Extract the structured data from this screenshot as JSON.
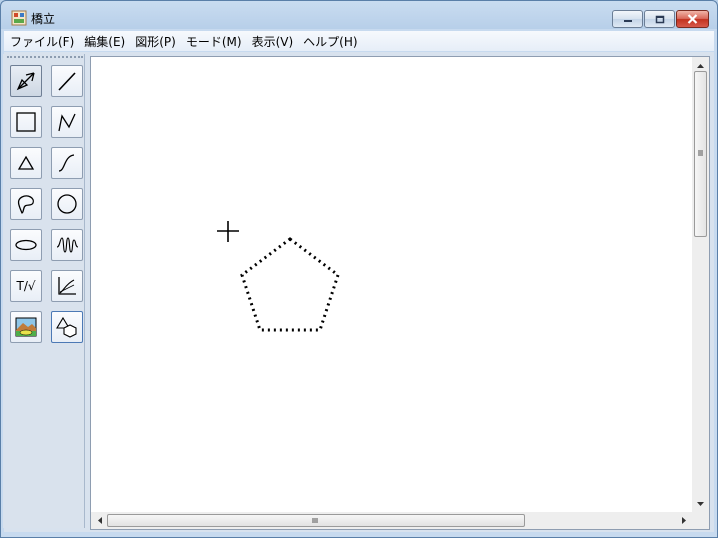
{
  "window": {
    "title": "橋立",
    "controls": {
      "minimize": "minimize-icon",
      "maximize": "maximize-icon",
      "close": "close-icon"
    }
  },
  "menubar": {
    "items": [
      "ファイル(F)",
      "編集(E)",
      "図形(P)",
      "モード(M)",
      "表示(V)",
      "ヘルプ(H)"
    ]
  },
  "toolbox": {
    "tools": [
      {
        "name": "select-arrow",
        "icon": "select-arrow-icon",
        "active": true
      },
      {
        "name": "line",
        "icon": "line-icon"
      },
      {
        "name": "rectangle",
        "icon": "rectangle-icon"
      },
      {
        "name": "polyline",
        "icon": "polyline-icon"
      },
      {
        "name": "triangle",
        "icon": "triangle-icon"
      },
      {
        "name": "curve",
        "icon": "curve-icon"
      },
      {
        "name": "freeform",
        "icon": "freeform-shape-icon"
      },
      {
        "name": "circle",
        "icon": "circle-icon"
      },
      {
        "name": "ellipse",
        "icon": "ellipse-icon"
      },
      {
        "name": "spring",
        "icon": "spring-coil-icon"
      },
      {
        "name": "text-formula",
        "label": "T/√"
      },
      {
        "name": "graph",
        "icon": "graph-axes-icon"
      },
      {
        "name": "image",
        "icon": "image-icon"
      },
      {
        "name": "shapes",
        "icon": "shapes-icon",
        "outlined": true
      }
    ]
  },
  "canvas": {
    "shapes": [
      {
        "type": "pentagon",
        "style": "dotted",
        "color": "#000000"
      }
    ],
    "cursor": "crosshair-cursor-icon"
  },
  "scrollbars": {
    "vertical_grip": "grip-icon",
    "horizontal_grip": "grip-icon"
  },
  "colors": {
    "titlebar": "#b7cfe9",
    "menubar": "#e6eef8",
    "toolbox": "#d9e2ed",
    "canvas": "#ffffff",
    "close_button": "#c2321f"
  }
}
